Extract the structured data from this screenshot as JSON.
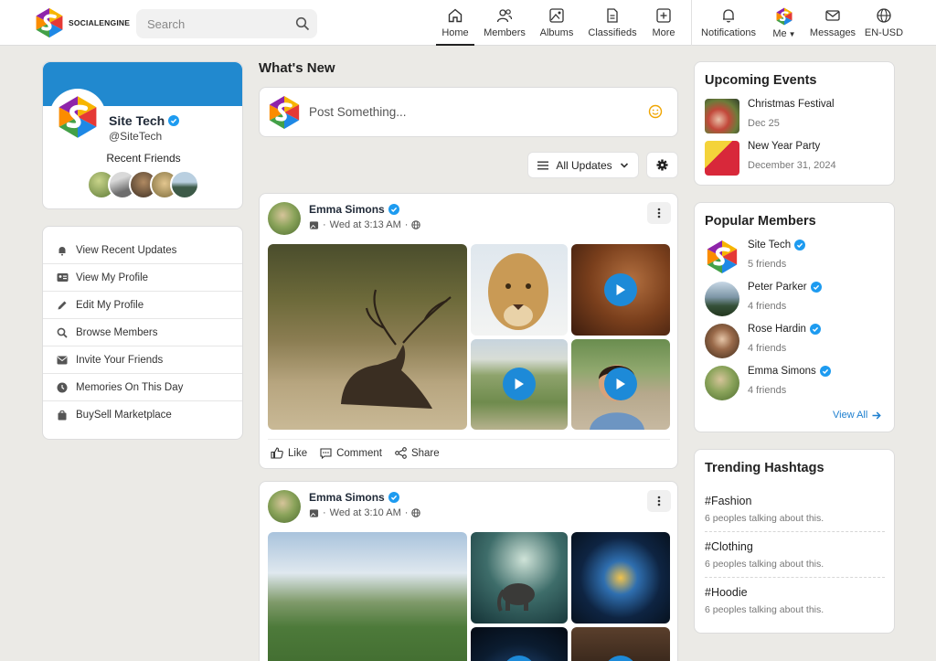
{
  "app": {
    "brand": "SOCIALENGINE"
  },
  "search": {
    "placeholder": "Search"
  },
  "nav": [
    {
      "label": "Home",
      "icon": "home-icon"
    },
    {
      "label": "Members",
      "icon": "members-icon"
    },
    {
      "label": "Albums",
      "icon": "albums-icon"
    },
    {
      "label": "Classifieds",
      "icon": "classifieds-icon"
    },
    {
      "label": "More",
      "icon": "plus-square-icon"
    },
    {
      "label": "Notifications",
      "icon": "bell-icon"
    },
    {
      "label": "Me",
      "icon": "avatar-icon"
    },
    {
      "label": "Messages",
      "icon": "mail-icon"
    },
    {
      "label": "EN-USD",
      "icon": "globe-icon"
    }
  ],
  "profile": {
    "name": "Site Tech",
    "handle": "@SiteTech",
    "recent_friends_label": "Recent Friends"
  },
  "menu": [
    {
      "label": "View Recent Updates",
      "icon": "bell-icon"
    },
    {
      "label": "View My Profile",
      "icon": "id-card-icon"
    },
    {
      "label": "Edit My Profile",
      "icon": "pencil-icon"
    },
    {
      "label": "Browse Members",
      "icon": "search-icon"
    },
    {
      "label": "Invite Your Friends",
      "icon": "envelope-icon"
    },
    {
      "label": "Memories On This Day",
      "icon": "clock-icon"
    },
    {
      "label": "BuySell Marketplace",
      "icon": "shopping-bag-icon"
    }
  ],
  "feed": {
    "title": "What's New",
    "composer_placeholder": "Post Something...",
    "filter_label": "All Updates",
    "posts": [
      {
        "author": "Emma Simons",
        "time": "Wed at 3:13 AM"
      },
      {
        "author": "Emma Simons",
        "time": "Wed at 3:10 AM"
      }
    ],
    "actions": {
      "like": "Like",
      "comment": "Comment",
      "share": "Share"
    }
  },
  "events": {
    "title": "Upcoming Events",
    "items": [
      {
        "name": "Christmas Festival",
        "date": "Dec 25"
      },
      {
        "name": "New Year Party",
        "date": "December 31, 2024"
      }
    ]
  },
  "members": {
    "title": "Popular Members",
    "items": [
      {
        "name": "Site Tech",
        "friends": "5 friends"
      },
      {
        "name": "Peter Parker",
        "friends": "4 friends"
      },
      {
        "name": "Rose Hardin",
        "friends": "4 friends"
      },
      {
        "name": "Emma Simons",
        "friends": "4 friends"
      }
    ],
    "view_all": "View All"
  },
  "hashtags": {
    "title": "Trending Hashtags",
    "items": [
      {
        "tag": "#Fashion",
        "stat": "6 peoples talking about this."
      },
      {
        "tag": "#Clothing",
        "stat": "6 peoples talking about this."
      },
      {
        "tag": "#Hoodie",
        "stat": "6 peoples talking about this."
      }
    ]
  },
  "colors": {
    "accent": "#2189cf",
    "verified": "#1d9bf0",
    "page_bg": "#ebeae6"
  }
}
